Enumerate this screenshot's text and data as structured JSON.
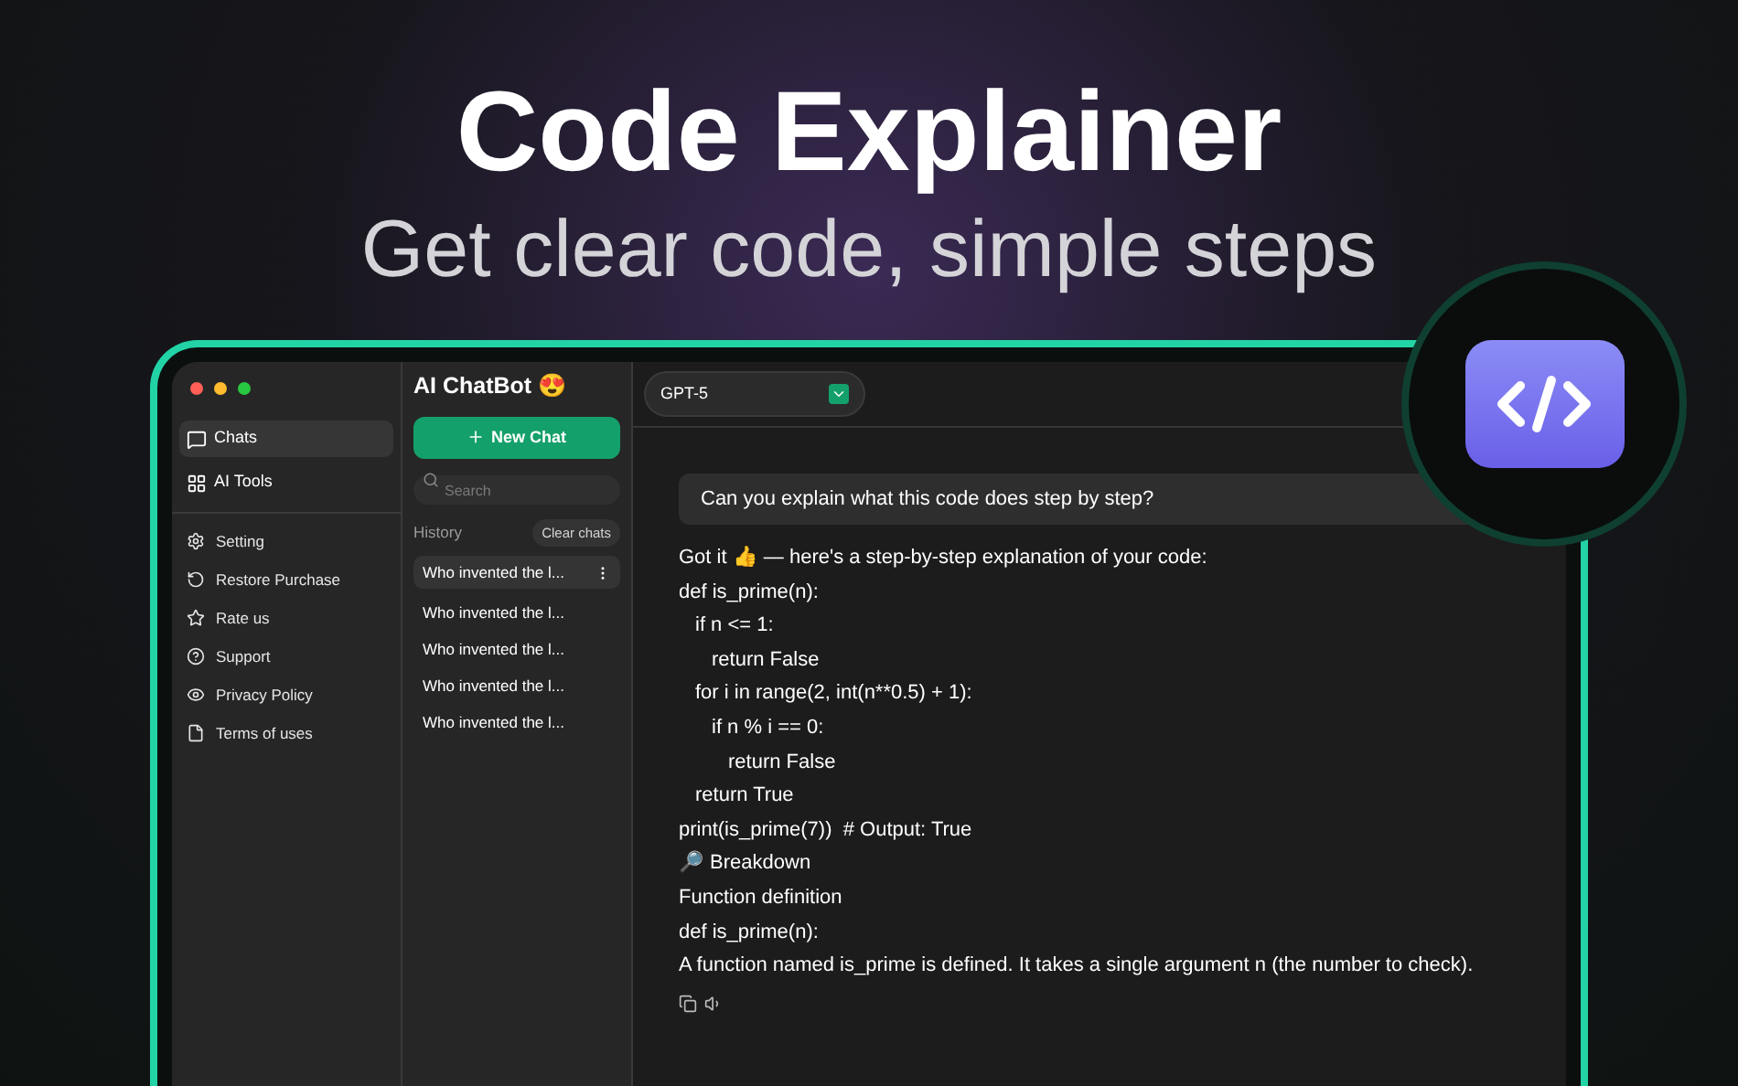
{
  "headline": "Code Explainer",
  "subheadline": "Get clear code, simple steps",
  "window": {
    "app_title": "AI ChatBot 😍"
  },
  "sidebar": {
    "items": [
      {
        "label": "Chats",
        "selected": true
      },
      {
        "label": "AI Tools",
        "selected": false
      }
    ],
    "settings": [
      {
        "label": "Setting"
      },
      {
        "label": "Restore Purchase"
      },
      {
        "label": "Rate us"
      },
      {
        "label": "Support"
      },
      {
        "label": "Privacy Policy"
      },
      {
        "label": "Terms of uses"
      }
    ]
  },
  "chat_list": {
    "new_chat": "New Chat",
    "search": {
      "placeholder": "Search"
    },
    "history_label": "History",
    "clear_button": "Clear chats",
    "items": [
      {
        "title": "Who invented the l...",
        "selected": true
      },
      {
        "title": "Who invented the l...",
        "selected": false
      },
      {
        "title": "Who invented the l...",
        "selected": false
      },
      {
        "title": "Who invented the l...",
        "selected": false
      },
      {
        "title": "Who invented the l...",
        "selected": false
      }
    ]
  },
  "conversation": {
    "model": "GPT-5",
    "question": "Can you explain what this code does step by step?",
    "answer": [
      {
        "text": "Got it 👍 — here's a step-by-step explanation of your code:",
        "kind": "flush"
      },
      {
        "text": "def is_prime(n):",
        "kind": "flush"
      },
      {
        "text": "if n <= 1:",
        "kind": "single"
      },
      {
        "text": "return False",
        "kind": "double"
      },
      {
        "text": "for i in range(2, int(n**0.5) + 1):",
        "kind": "single"
      },
      {
        "text": "if n % i == 0:",
        "kind": "double"
      },
      {
        "text": "return False",
        "kind": "triple"
      },
      {
        "text": "return True",
        "kind": "single"
      },
      {
        "text": "print(is_prime(7))  # Output: True",
        "kind": "flush"
      },
      {
        "text": "🔎 Breakdown",
        "kind": "flush"
      },
      {
        "text": "Function definition",
        "kind": "flush"
      },
      {
        "text": "def is_prime(n):",
        "kind": "flush"
      },
      {
        "text": "A function named is_prime is defined. It takes a single argument n (the number to check).",
        "kind": "flush"
      }
    ]
  }
}
